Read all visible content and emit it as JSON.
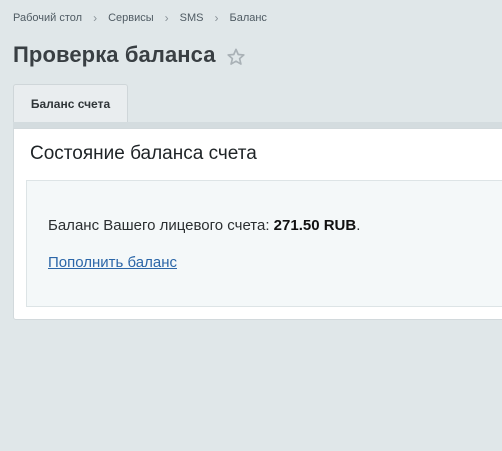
{
  "breadcrumb": {
    "items": [
      "Рабочий стол",
      "Сервисы",
      "SMS",
      "Баланс"
    ],
    "separator": "›"
  },
  "page": {
    "title": "Проверка баланса",
    "favorite_icon": "star-outline-icon"
  },
  "tabs": [
    {
      "label": "Баланс счета",
      "active": true
    }
  ],
  "section": {
    "title": "Состояние баланса счета",
    "balance_text": "Баланс Вашего лицевого счета: ",
    "balance_value": "271.50 RUB",
    "balance_suffix": ".",
    "topup_link": "Пополнить баланс"
  },
  "colors": {
    "background": "#e0e7e9",
    "link": "#2b66a8",
    "panel": "#ffffff",
    "content_box": "#f4f8f9"
  }
}
